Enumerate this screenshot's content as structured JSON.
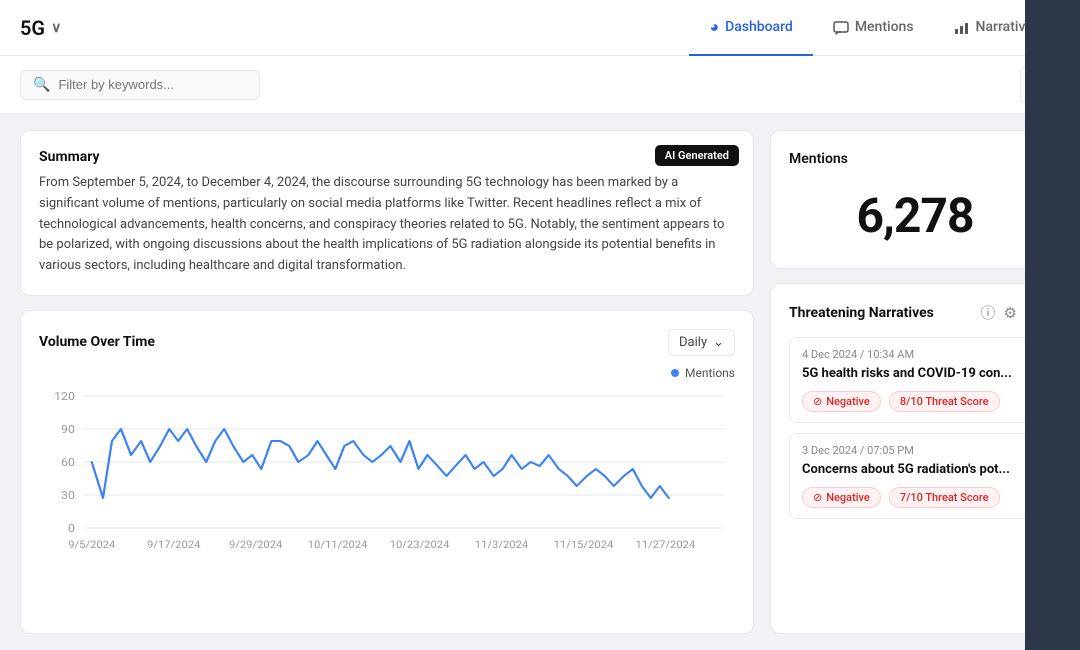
{
  "header": {
    "title": "5G",
    "chevron": "∨",
    "nav": [
      {
        "id": "dashboard",
        "label": "Dashboard",
        "icon": "◕",
        "active": true
      },
      {
        "id": "mentions",
        "label": "Mentions",
        "icon": "💬",
        "active": false
      },
      {
        "id": "narratives",
        "label": "Narratives",
        "icon": "📊",
        "active": false
      }
    ]
  },
  "search": {
    "placeholder": "Filter by keywords..."
  },
  "summary": {
    "ai_badge": "AI Generated",
    "title": "Summary",
    "text": "From September 5, 2024, to December 4, 2024, the discourse surrounding 5G technology has been marked by a significant volume of mentions, particularly on social media platforms like Twitter. Recent headlines reflect a mix of technological advancements, health concerns, and conspiracy theories related to 5G. Notably, the sentiment appears to be polarized, with ongoing discussions about the health implications of 5G radiation alongside its potential benefits in various sectors, including healthcare and digital transformation."
  },
  "mentions": {
    "title": "Mentions",
    "count": "6,278"
  },
  "volume": {
    "title": "Volume Over Time",
    "selector_label": "Daily",
    "legend_label": "Mentions",
    "y_labels": [
      "120",
      "90",
      "60",
      "30",
      "0"
    ],
    "x_labels": [
      "9/5/2024",
      "9/17/2024",
      "9/29/2024",
      "10/11/2024",
      "10/23/2024",
      "11/3/2024",
      "11/15/2024",
      "11/27/2024"
    ]
  },
  "threatening_narratives": {
    "title": "Threatening Narratives",
    "items": [
      {
        "date": "4 Dec 2024 / 10:34 AM",
        "headline": "5G health risks and COVID-19 con...",
        "sentiment": "Negative",
        "threat_score": "8/10 Threat Score"
      },
      {
        "date": "3 Dec 2024 / 07:05 PM",
        "headline": "Concerns about 5G radiation's pot...",
        "sentiment": "Negative",
        "threat_score": "7/10 Threat Score"
      }
    ]
  },
  "icons": {
    "search": "🔍",
    "filter": "⊟",
    "chevron_down": "⌄",
    "info": "ⓘ",
    "gear": "⚙",
    "arrow_right": "→",
    "negative_circle": "⊘"
  }
}
